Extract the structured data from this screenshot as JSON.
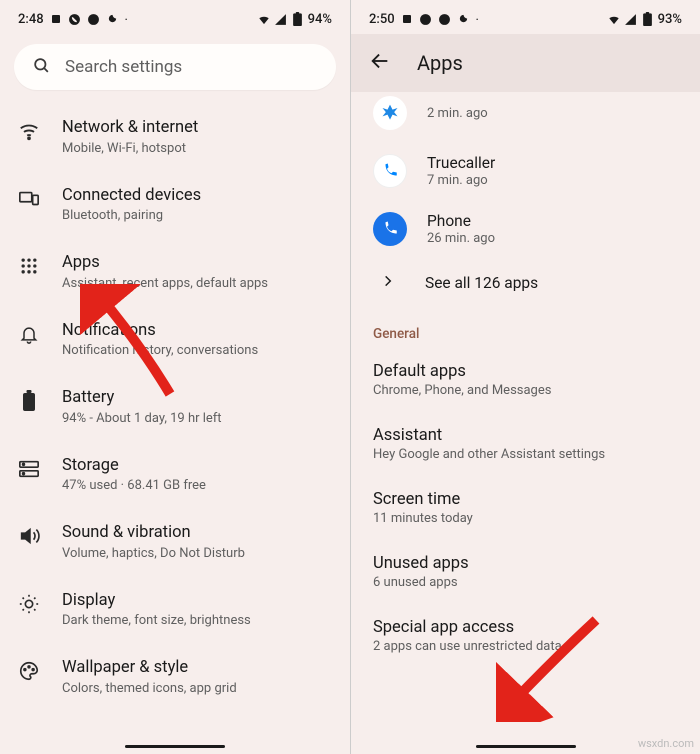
{
  "left": {
    "status": {
      "time": "2:48",
      "battery": "94%"
    },
    "search_placeholder": "Search settings",
    "items": [
      {
        "title": "Network & internet",
        "subtitle": "Mobile, Wi-Fi, hotspot"
      },
      {
        "title": "Connected devices",
        "subtitle": "Bluetooth, pairing"
      },
      {
        "title": "Apps",
        "subtitle": "Assistant, recent apps, default apps"
      },
      {
        "title": "Notifications",
        "subtitle": "Notification history, conversations"
      },
      {
        "title": "Battery",
        "subtitle": "94% - About 1 day, 19 hr left"
      },
      {
        "title": "Storage",
        "subtitle": "47% used · 68.41 GB free"
      },
      {
        "title": "Sound & vibration",
        "subtitle": "Volume, haptics, Do Not Disturb"
      },
      {
        "title": "Display",
        "subtitle": "Dark theme, font size, brightness"
      },
      {
        "title": "Wallpaper & style",
        "subtitle": "Colors, themed icons, app grid"
      }
    ]
  },
  "right": {
    "status": {
      "time": "2:50",
      "battery": "93%"
    },
    "page_title": "Apps",
    "recent": [
      {
        "name": "",
        "time": "2 min. ago"
      },
      {
        "name": "Truecaller",
        "time": "7 min. ago"
      },
      {
        "name": "Phone",
        "time": "26 min. ago"
      }
    ],
    "see_all": "See all 126 apps",
    "general_label": "General",
    "general": [
      {
        "title": "Default apps",
        "subtitle": "Chrome, Phone, and Messages"
      },
      {
        "title": "Assistant",
        "subtitle": "Hey Google and other Assistant settings"
      },
      {
        "title": "Screen time",
        "subtitle": "11 minutes today"
      },
      {
        "title": "Unused apps",
        "subtitle": "6 unused apps"
      },
      {
        "title": "Special app access",
        "subtitle": "2 apps can use unrestricted data"
      }
    ]
  },
  "watermark": "wsxdn.com"
}
